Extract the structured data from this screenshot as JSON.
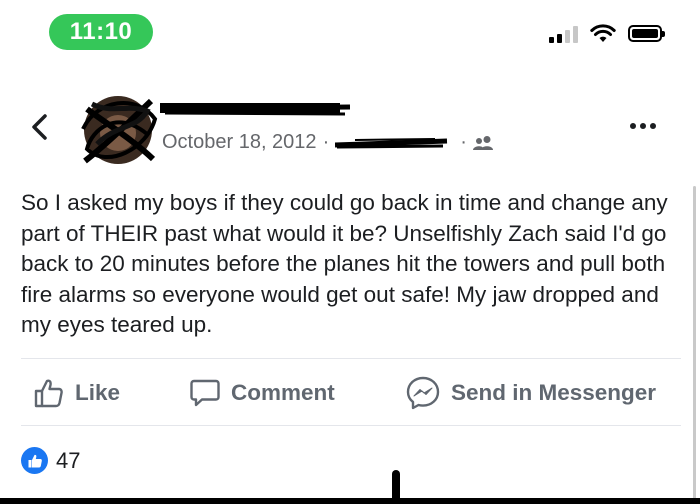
{
  "status_bar": {
    "time": "11:10"
  },
  "post": {
    "date": "October 18, 2012",
    "separator": "·",
    "text": "So I asked my boys if they could go back in time and change any part of THEIR past what would it be? Unselfishly Zach said I'd go back to 20 minutes before the planes hit the towers and pull both fire alarms so everyone would get out safe! My jaw dropped and my eyes teared up.",
    "audience_icon": "friends-icon"
  },
  "actions": {
    "like_label": "Like",
    "comment_label": "Comment",
    "send_label": "Send in Messenger"
  },
  "reactions": {
    "count": "47"
  },
  "colors": {
    "time_pill": "#35c759",
    "like_blue": "#1a77f2",
    "secondary_text": "#65676b",
    "action_text": "#606770"
  }
}
